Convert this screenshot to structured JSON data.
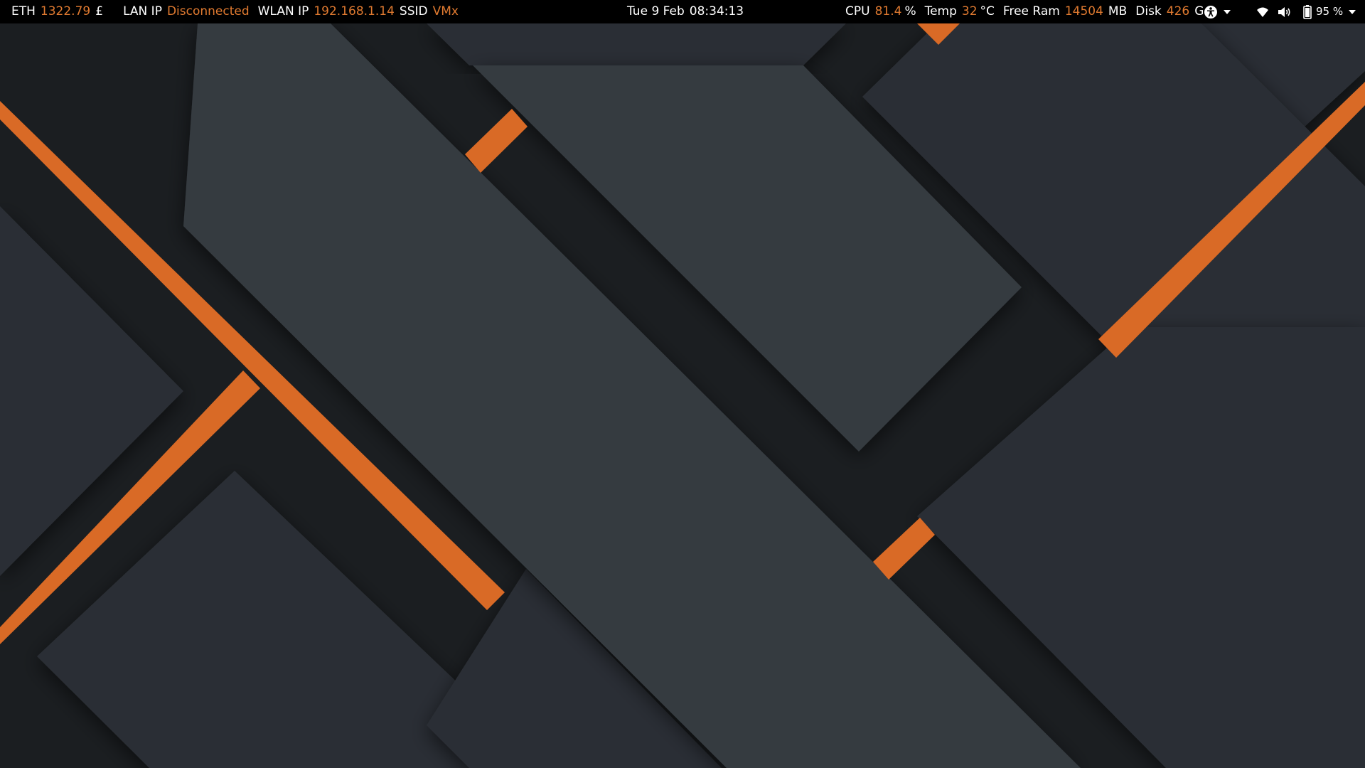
{
  "topbar": {
    "eth": {
      "label": "ETH",
      "value": "1322.79",
      "unit": "£"
    },
    "lan_ip": {
      "label": "LAN IP",
      "value": "Disconnected"
    },
    "wlan_ip": {
      "label": "WLAN IP",
      "value": "192.168.1.14"
    },
    "ssid": {
      "label": "SSID",
      "value": "VMx"
    },
    "clock": {
      "date": "Tue 9 Feb",
      "time": "08:34:13"
    },
    "cpu": {
      "label": "CPU",
      "value": "81.4",
      "unit": "%"
    },
    "temp": {
      "label": "Temp",
      "value": "32",
      "unit": "°C"
    },
    "ram": {
      "label": "Free Ram",
      "value": "14504",
      "unit": "MB"
    },
    "disk": {
      "label": "Disk",
      "value": "426",
      "unit": "G"
    },
    "tray": {
      "accessibility_icon": "accessibility-icon",
      "wifi_icon": "wifi-icon",
      "volume_icon": "volume-icon",
      "battery_icon": "battery-icon",
      "battery_percent": "95 %"
    }
  },
  "colors": {
    "bar_background": "#000000",
    "bar_text": "#ffffff",
    "accent": "#e07a30",
    "wallpaper_dark": "#1b1e21",
    "wallpaper_mid": "#2b2f34",
    "wallpaper_light": "#353a3f",
    "wallpaper_stripe": "#d96a26"
  }
}
